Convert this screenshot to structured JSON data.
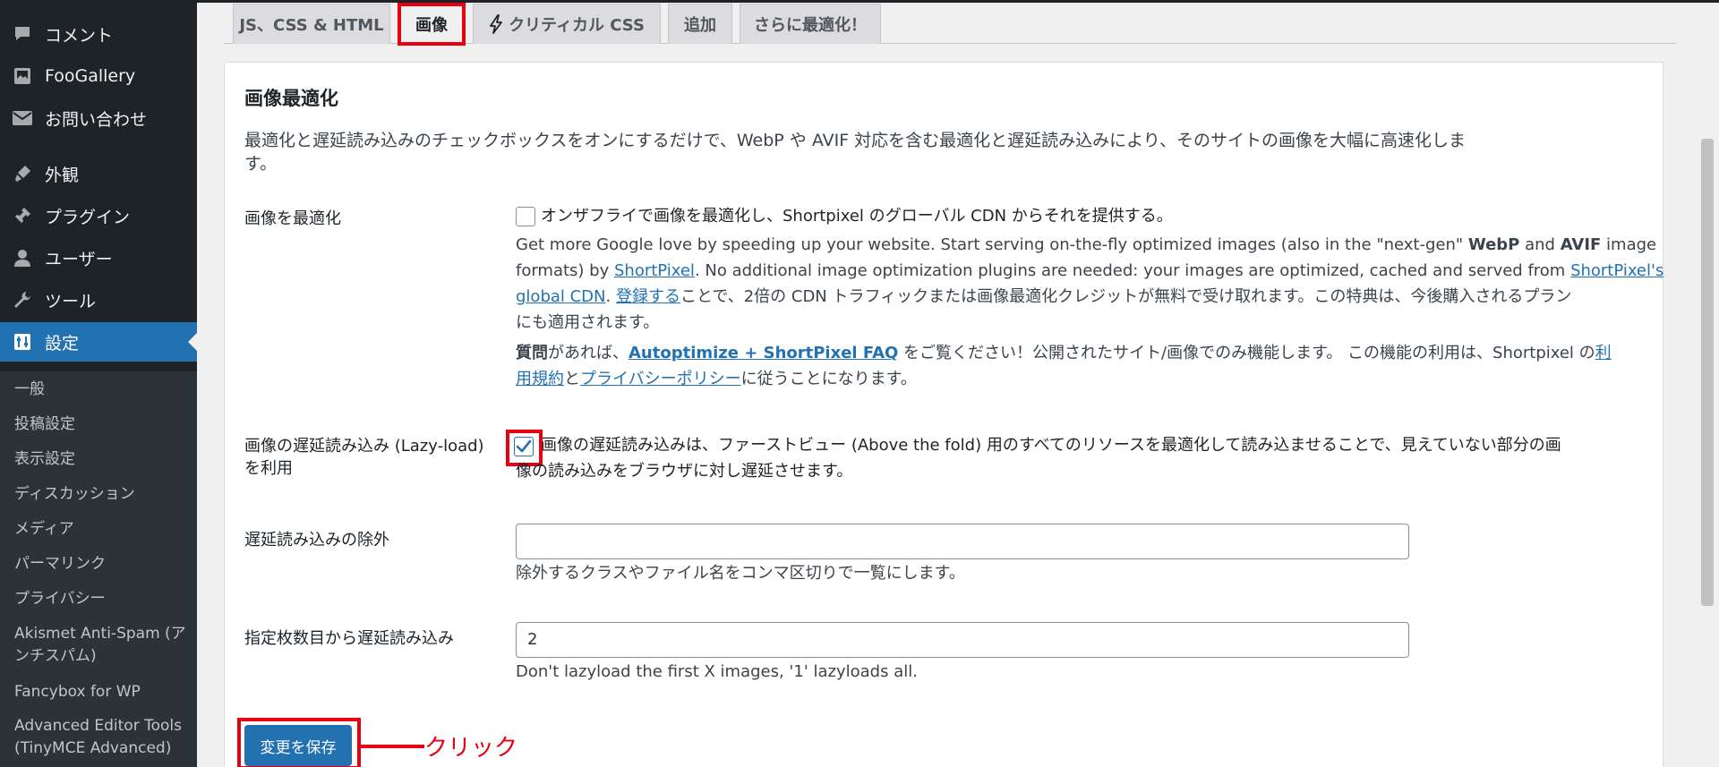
{
  "sidebar": {
    "menu": [
      {
        "label": "コメント",
        "icon": "comment-icon"
      },
      {
        "label": "FooGallery",
        "icon": "gallery-icon"
      },
      {
        "label": "お問い合わせ",
        "icon": "mail-icon"
      },
      {
        "label": "外観",
        "icon": "brush-icon"
      },
      {
        "label": "プラグイン",
        "icon": "plugin-icon"
      },
      {
        "label": "ユーザー",
        "icon": "user-icon"
      },
      {
        "label": "ツール",
        "icon": "wrench-icon"
      },
      {
        "label": "設定",
        "icon": "settings-icon",
        "active": true
      }
    ],
    "submenu": [
      "一般",
      "投稿設定",
      "表示設定",
      "ディスカッション",
      "メディア",
      "パーマリンク",
      "プライバシー",
      "Akismet Anti-Spam (アンチスパム)",
      "Fancybox for WP",
      "Advanced Editor Tools (TinyMCE Advanced)"
    ]
  },
  "tabs": [
    {
      "label": "JS、CSS & HTML"
    },
    {
      "label": "画像",
      "active": true
    },
    {
      "label": "クリティカル CSS",
      "icon": "lightning-icon"
    },
    {
      "label": "追加"
    },
    {
      "label": "さらに最適化！"
    }
  ],
  "section": {
    "title": "画像最適化",
    "desc_line1": "最適化と遅延読み込みのチェックボックスをオンにするだけで、WebP や AVIF 対応を含む最適化と遅延読み込みにより、そのサイトの画像を大幅に高速化しま",
    "desc_line2": "す。"
  },
  "optimize": {
    "label": "画像を最適化",
    "checkbox_label": "オンザフライで画像を最適化し、Shortpixel のグローバル CDN からそれを提供する。",
    "checked": false,
    "p1_l1_a": "Get more Google love by speeding up your website. Start serving on-the-fly optimized images (also in the \"next-gen\" ",
    "p1_l1_b": "WebP",
    "p1_l1_c": " and ",
    "p1_l1_d": "AVIF",
    "p1_l1_e": " image",
    "p1_l2_a": "formats) by ",
    "p1_l2_link": "ShortPixel",
    "p1_l2_b": ". No additional image optimization plugins are needed: your images are optimized, cached and served from ",
    "p1_l2_link2": "ShortPixel's",
    "p1_l3_link": "global CDN",
    "p1_l3_a": ". ",
    "p1_l3_link2": "登録する",
    "p1_l3_b": "ことで、2倍の CDN トラフィックまたは画像最適化クレジットが無料で受け取れます。この特典は、今後購入されるプラン",
    "p1_l4": "にも適用されます。",
    "p2_l1_bold": "質問",
    "p2_l1_a": "があれば、",
    "p2_l1_link": "Autoptimize + ShortPixel FAQ",
    "p2_l1_b": " をご覧ください！公開されたサイト/画像でのみ機能します。 この機能の利用は、Shortpixel の",
    "p2_l1_link2": "利",
    "p2_l2_link": "用規約",
    "p2_l2_a": "と",
    "p2_l2_link2": "プライバシーポリシー",
    "p2_l2_b": "に従うことになります。"
  },
  "lazyload": {
    "label_l1": "画像の遅延読み込み (Lazy-load)",
    "label_l2": "を利用",
    "checked": true,
    "text_l1": "画像の遅延読み込みは、ファーストビュー (Above the fold) 用のすべてのリソースを最適化して読み込ませることで、見えていない部分の画",
    "text_l2": "像の読み込みをブラウザに対し遅延させます。"
  },
  "exclude": {
    "label": "遅延読み込みの除外",
    "value": "",
    "help": "除外するクラスやファイル名をコンマ区切りで一覧にします。"
  },
  "from_nth": {
    "label": "指定枚数目から遅延読み込み",
    "value": "2",
    "help": "Don't lazyload the first X images, '1' lazyloads all."
  },
  "save_button": "変更を保存",
  "annotation": "クリック",
  "colors": {
    "accent": "#2271b1",
    "highlight": "#e60012",
    "sidebar": "#1d2327"
  }
}
